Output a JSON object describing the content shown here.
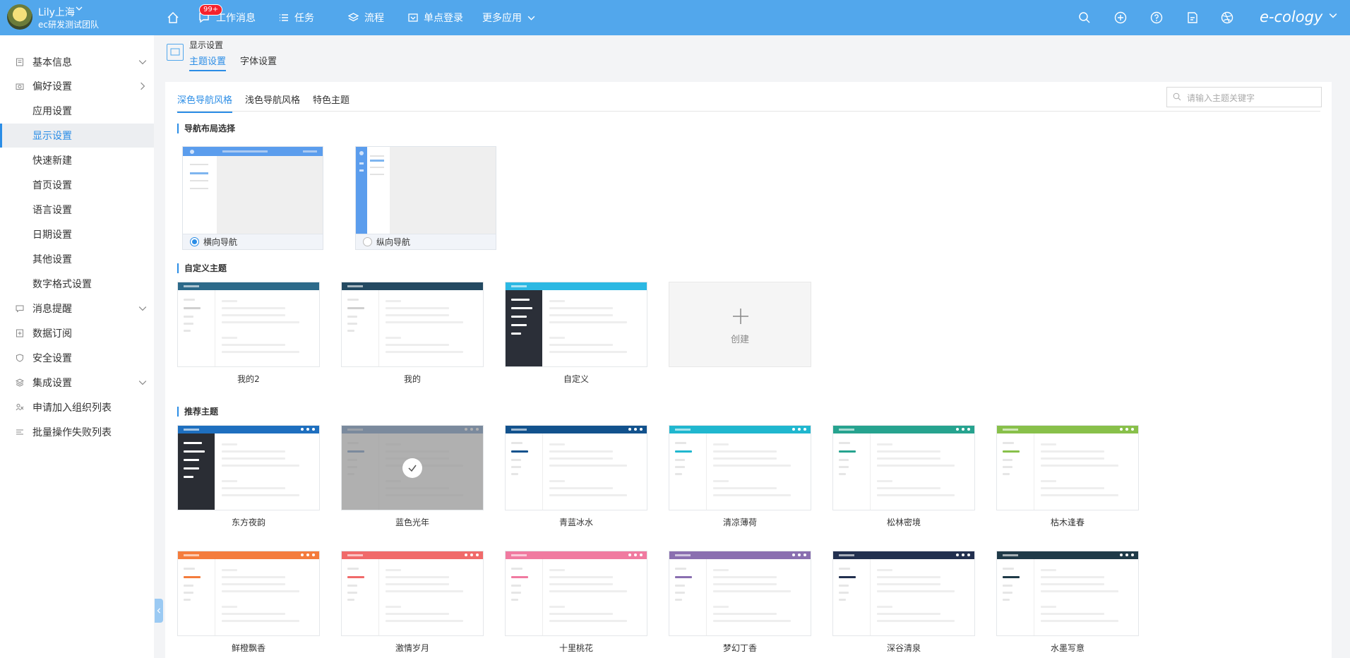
{
  "user": {
    "name": "Lily上海",
    "team": "ec研发测试团队"
  },
  "topnav": [
    {
      "label": "工作消息",
      "icon": "message-icon"
    },
    {
      "label": "任务",
      "icon": "task-list-icon"
    },
    {
      "label": "流程",
      "icon": "workflow-icon"
    },
    {
      "label": "单点登录",
      "icon": "sso-icon"
    },
    {
      "label": "更多应用",
      "icon": "chevron-down-icon"
    }
  ],
  "badge": "99+",
  "brand": "e-cology",
  "sidebar": {
    "items": [
      {
        "label": "基本信息",
        "icon": "document-icon"
      },
      {
        "label": "偏好设置",
        "icon": "camera-icon"
      },
      {
        "label": "应用设置"
      },
      {
        "label": "显示设置",
        "active": true
      },
      {
        "label": "快速新建"
      },
      {
        "label": "首页设置"
      },
      {
        "label": "语言设置"
      },
      {
        "label": "日期设置"
      },
      {
        "label": "其他设置"
      },
      {
        "label": "数字格式设置"
      },
      {
        "label": "消息提醒",
        "icon": "chat-icon"
      },
      {
        "label": "数据订阅",
        "icon": "subscribe-icon"
      },
      {
        "label": "安全设置",
        "icon": "shield-icon"
      },
      {
        "label": "集成设置",
        "icon": "layers-icon"
      },
      {
        "label": "申请加入组织列表",
        "icon": "org-icon"
      },
      {
        "label": "批量操作失败列表",
        "icon": "list-icon"
      }
    ]
  },
  "page": {
    "title": "显示设置",
    "tabs": [
      "主题设置",
      "字体设置"
    ]
  },
  "content": {
    "tabs": [
      "深色导航风格",
      "浅色导航风格",
      "特色主题"
    ],
    "search_placeholder": "请输入主题关键字",
    "sections": {
      "layout": "导航布局选择",
      "custom": "自定义主题",
      "recommended": "推荐主题"
    },
    "layouts": [
      {
        "label": "横向导航",
        "selected": true
      },
      {
        "label": "纵向导航",
        "selected": false
      }
    ],
    "custom_themes": [
      {
        "label": "我的2",
        "header": "#2d6a8a",
        "side": "#ffffff",
        "accent": "#d0d0d0"
      },
      {
        "label": "我的",
        "header": "#244a62",
        "side": "#ffffff",
        "accent": "#d0d0d0"
      },
      {
        "label": "自定义",
        "header": "#2cb8e3",
        "side": "#2b2f38",
        "accent": "#ffffff"
      }
    ],
    "create_label": "创建",
    "recommended_themes": [
      {
        "label": "东方夜韵",
        "header": "#1e6fbf",
        "side": "#2a2d34",
        "accent": "#ffffff"
      },
      {
        "label": "蓝色光年",
        "header": "#2c68b3",
        "side": "#ffffff",
        "accent": "#2c68b3",
        "selected": true
      },
      {
        "label": "青蓝冰水",
        "header": "#12528d",
        "side": "#ffffff",
        "accent": "#12528d"
      },
      {
        "label": "清凉薄荷",
        "header": "#20b7cf",
        "side": "#ffffff",
        "accent": "#20b7cf"
      },
      {
        "label": "松林密境",
        "header": "#26a38f",
        "side": "#ffffff",
        "accent": "#26a38f"
      },
      {
        "label": "枯木逢春",
        "header": "#88c04a",
        "side": "#ffffff",
        "accent": "#88c04a"
      },
      {
        "label": "鲜橙飘香",
        "header": "#f47c3c",
        "side": "#ffffff",
        "accent": "#f47c3c"
      },
      {
        "label": "激情岁月",
        "header": "#f06a6a",
        "side": "#ffffff",
        "accent": "#f06a6a"
      },
      {
        "label": "十里桃花",
        "header": "#f07aa0",
        "side": "#ffffff",
        "accent": "#f07aa0"
      },
      {
        "label": "梦幻丁香",
        "header": "#8a6fb0",
        "side": "#ffffff",
        "accent": "#8a6fb0"
      },
      {
        "label": "深谷清泉",
        "header": "#22304f",
        "side": "#ffffff",
        "accent": "#22304f"
      },
      {
        "label": "水墨写意",
        "header": "#1f3a48",
        "side": "#ffffff",
        "accent": "#1f3a48"
      }
    ]
  }
}
